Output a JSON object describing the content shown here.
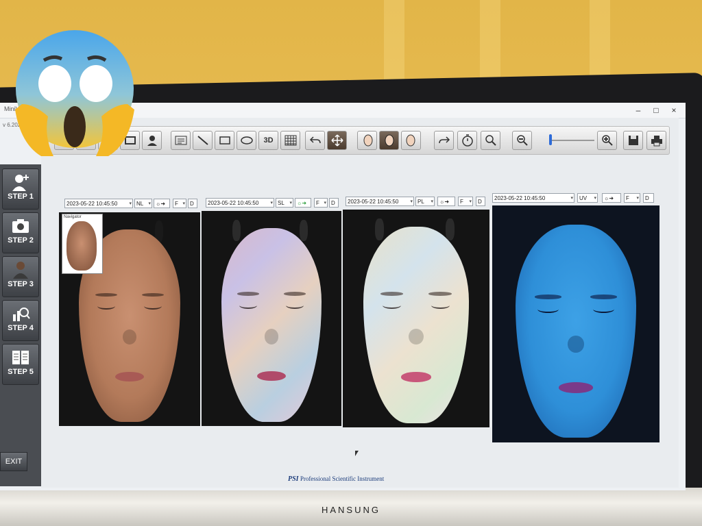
{
  "window": {
    "title": "MiniVis",
    "subtitle": "v 6.2023.5"
  },
  "window_controls": {
    "minimize": "–",
    "maximize": "□",
    "close": "×"
  },
  "steps": [
    {
      "label": "STEP 1",
      "icon": "add-user-icon"
    },
    {
      "label": "STEP 2",
      "icon": "camera-icon"
    },
    {
      "label": "STEP 3",
      "icon": "person-icon"
    },
    {
      "label": "STEP 4",
      "icon": "magnify-chart-icon"
    },
    {
      "label": "STEP 5",
      "icon": "report-icon"
    }
  ],
  "exit_label": "EXIT",
  "toolbar": {
    "three_d_label": "3D"
  },
  "panels": [
    {
      "datetime": "2023-05-22 10:45:50",
      "mode": "NL",
      "view": "F",
      "dropdown2": "D"
    },
    {
      "datetime": "2023-05-22 10:45:50",
      "mode": "SL",
      "view": "F",
      "dropdown2": "D"
    },
    {
      "datetime": "2023-05-22 10:45:50",
      "mode": "PL",
      "view": "F",
      "dropdown2": "D"
    },
    {
      "datetime": "2023-05-22 10:45:50",
      "mode": "UV",
      "view": "F",
      "dropdown2": "D"
    }
  ],
  "navigator_label": "Navigator",
  "footer": {
    "logo": "PSI",
    "text": "Professional Scientific Instrument"
  },
  "monitor_brand": "HANSUNG",
  "colors": {
    "accent": "#2d6bd8",
    "uv_face": "#2e8fd8",
    "nl_face": "#b97d5a"
  }
}
